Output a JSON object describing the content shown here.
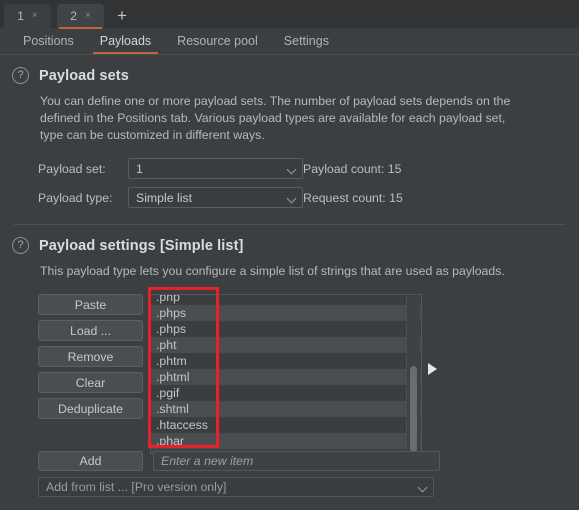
{
  "window": {
    "accent_color": "#c1643c",
    "annotation_color": "#e8202a"
  },
  "attack_tabs": {
    "items": [
      {
        "label": "1",
        "close": "×",
        "active": false
      },
      {
        "label": "2",
        "close": "×",
        "active": true
      }
    ],
    "add_label": "+"
  },
  "section_tabs": [
    {
      "label": "Positions",
      "active": false
    },
    {
      "label": "Payloads",
      "active": true
    },
    {
      "label": "Resource pool",
      "active": false
    },
    {
      "label": "Settings",
      "active": false
    }
  ],
  "payload_sets": {
    "help_icon": "question-mark-icon",
    "title": "Payload sets",
    "description": "You can define one or more payload sets. The number of payload sets depends on the\ndefined in the Positions tab. Various payload types are available for each payload set,\ntype can be customized in different ways.",
    "payload_set_label": "Payload set:",
    "payload_set_value": "1",
    "payload_type_label": "Payload type:",
    "payload_type_value": "Simple list",
    "payload_count": "Payload count:  15",
    "request_count": "Request count: 15"
  },
  "payload_settings": {
    "help_icon": "question-mark-icon",
    "title": "Payload settings [Simple list]",
    "description": "This payload type lets you configure a simple list of strings that are used as payloads.",
    "buttons": [
      {
        "label": "Paste"
      },
      {
        "label": "Load ..."
      },
      {
        "label": "Remove"
      },
      {
        "label": "Clear"
      },
      {
        "label": "Deduplicate"
      }
    ],
    "list_items": [
      ".php",
      ".phps",
      ".phps",
      ".pht",
      ".phtm",
      ".phtml",
      ".pgif",
      ".shtml",
      ".htaccess",
      ".phar"
    ],
    "add_button": "Add",
    "new_item_placeholder": "Enter a new item",
    "add_from_list": "Add from list ... [Pro version only]"
  }
}
